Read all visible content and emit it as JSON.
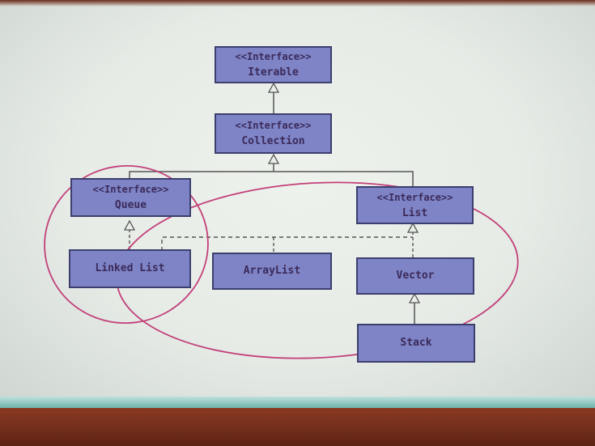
{
  "diagram": {
    "iterable": {
      "stereotype": "<<Interface>>",
      "name": "Iterable"
    },
    "collection": {
      "stereotype": "<<Interface>>",
      "name": "Collection"
    },
    "queue": {
      "stereotype": "<<Interface>>",
      "name": "Queue"
    },
    "list": {
      "stereotype": "<<Interface>>",
      "name": "List"
    },
    "linkedlist": {
      "name": "Linked List"
    },
    "arraylist": {
      "name": "ArrayList"
    },
    "vector": {
      "name": "Vector"
    },
    "stack": {
      "name": "Stack"
    }
  },
  "colors": {
    "box_fill": "#7e84c6",
    "box_border": "#3c3f6e",
    "annotation_circle": "#c2407a",
    "screen": "#e9eee9"
  }
}
